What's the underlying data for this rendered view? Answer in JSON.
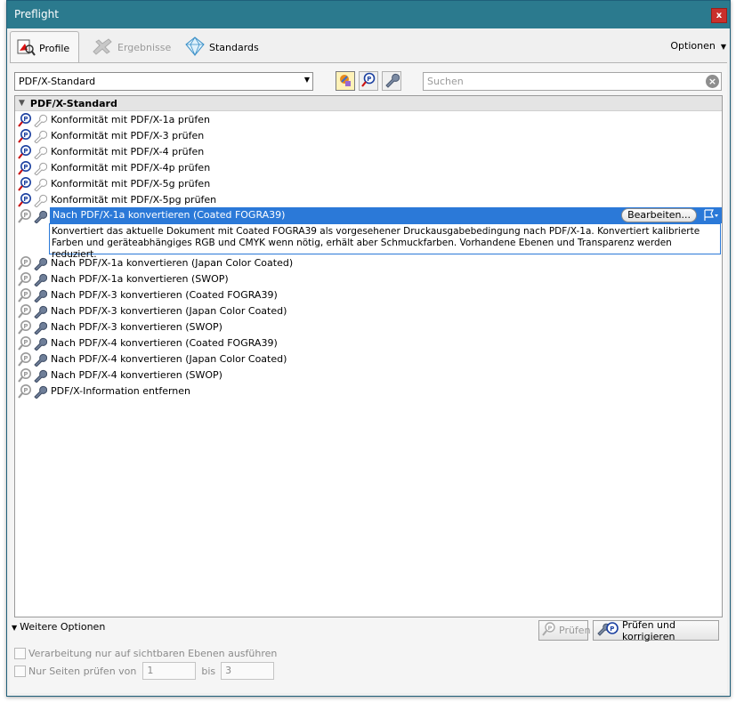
{
  "window": {
    "title": "Preflight",
    "close_label": "x"
  },
  "tabs": [
    {
      "label": "Profile",
      "icon": "profile-icon",
      "active": true
    },
    {
      "label": "Ergebnisse",
      "icon": "results-icon",
      "active": false
    },
    {
      "label": "Standards",
      "icon": "standards-icon",
      "active": false
    }
  ],
  "options_menu": {
    "label": "Optionen"
  },
  "toolbar": {
    "profile_select": "PDF/X-Standard",
    "search_placeholder": "Suchen"
  },
  "list": {
    "group_header": "PDF/X-Standard",
    "check_items": [
      "Konformität mit PDF/X-1a prüfen",
      "Konformität mit PDF/X-3 prüfen",
      "Konformität mit PDF/X-4 prüfen",
      "Konformität mit PDF/X-4p prüfen",
      "Konformität mit PDF/X-5g prüfen",
      "Konformität mit PDF/X-5pg prüfen"
    ],
    "selected_item": "Nach PDF/X-1a konvertieren (Coated FOGRA39)",
    "edit_button": "Bearbeiten...",
    "selected_description": "Konvertiert das aktuelle Dokument mit Coated FOGRA39 als vorgesehener Druckausgabebedingung nach PDF/X-1a. Konvertiert kalibrierte Farben und geräteabhängiges RGB und CMYK wenn nötig, erhält aber Schmuckfarben. Vorhandene Ebenen und Transparenz werden reduziert.",
    "convert_items": [
      "Nach PDF/X-1a konvertieren (Japan Color Coated)",
      "Nach PDF/X-1a konvertieren (SWOP)",
      "Nach PDF/X-3 konvertieren (Coated FOGRA39)",
      "Nach PDF/X-3 konvertieren (Japan Color Coated)",
      "Nach PDF/X-3 konvertieren (SWOP)",
      "Nach PDF/X-4 konvertieren (Coated FOGRA39)",
      "Nach PDF/X-4 konvertieren (Japan Color Coated)",
      "Nach PDF/X-4 konvertieren (SWOP)",
      "PDF/X-Information entfernen"
    ]
  },
  "bottom": {
    "more_options": "Weitere Optionen",
    "check_button": "Prüfen",
    "check_fix_button": "Prüfen und korrigieren",
    "visible_layers_label": "Verarbeitung nur auf sichtbaren Ebenen ausführen",
    "pages_label": "Nur Seiten prüfen von",
    "page_from": "1",
    "bis_label": "bis",
    "page_to": "3"
  },
  "colors": {
    "titlebar": "#2b7a8e",
    "selection": "#2b79d8",
    "close": "#c9302c"
  }
}
